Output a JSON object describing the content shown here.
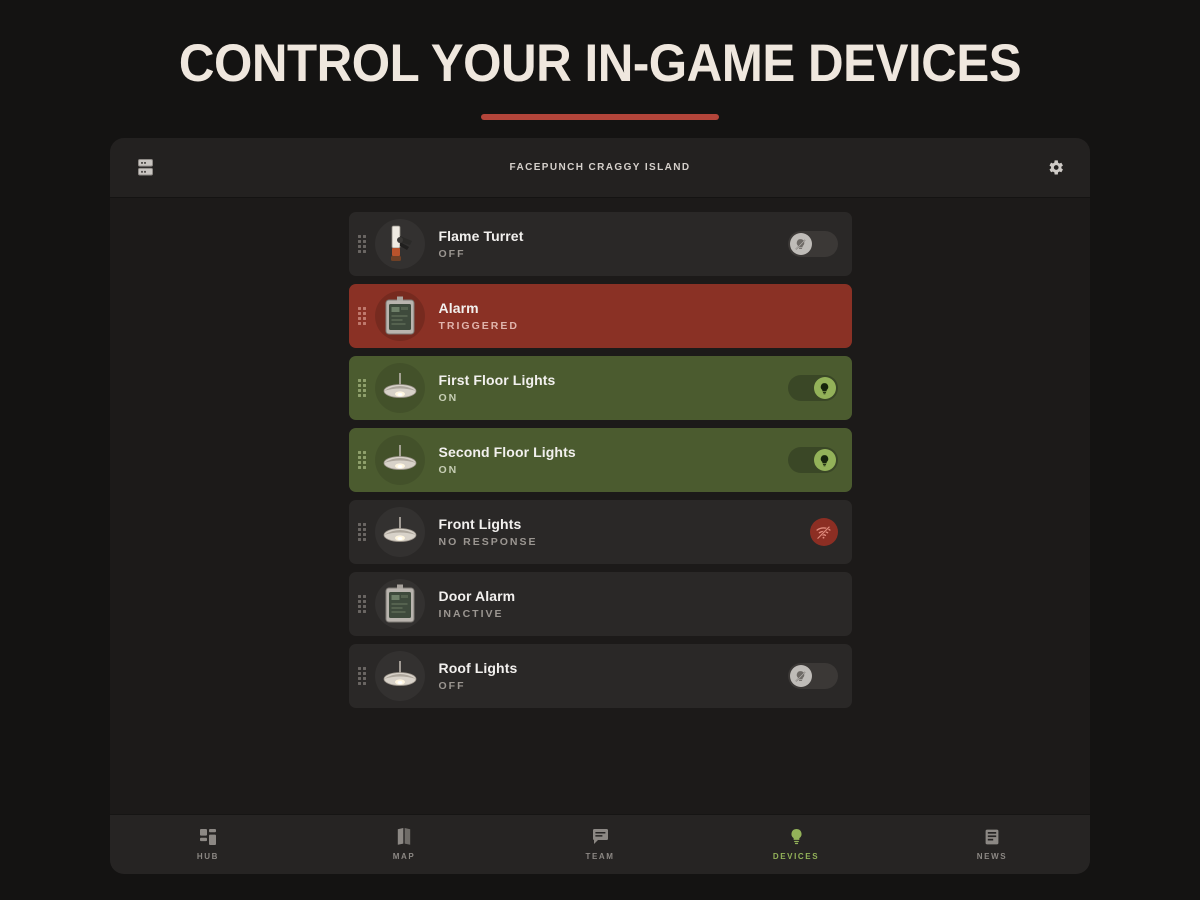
{
  "heading": {
    "title": "Control Your In-Game Devices",
    "accent_color": "#B4453A"
  },
  "app": {
    "header": {
      "title": "FACEPUNCH CRAGGY ISLAND",
      "left_icon": "server-stack-icon",
      "right_icon": "gear-icon"
    },
    "devices": [
      {
        "name": "Flame Turret",
        "status": "OFF",
        "state": "off",
        "icon": "flame-turret-icon",
        "control": "toggle",
        "toggle_on": false
      },
      {
        "name": "Alarm",
        "status": "TRIGGERED",
        "state": "alert",
        "icon": "alarm-box-icon",
        "control": "none",
        "toggle_on": false
      },
      {
        "name": "First Floor Lights",
        "status": "ON",
        "state": "on",
        "icon": "ceiling-lamp-icon",
        "control": "toggle",
        "toggle_on": true
      },
      {
        "name": "Second Floor Lights",
        "status": "ON",
        "state": "on",
        "icon": "ceiling-lamp-icon",
        "control": "toggle",
        "toggle_on": true
      },
      {
        "name": "Front Lights",
        "status": "NO RESPONSE",
        "state": "off",
        "icon": "ceiling-lamp-icon",
        "control": "offline",
        "toggle_on": false
      },
      {
        "name": "Door Alarm",
        "status": "INACTIVE",
        "state": "off",
        "icon": "alarm-box-icon",
        "control": "none",
        "toggle_on": false
      },
      {
        "name": "Roof Lights",
        "status": "OFF",
        "state": "off",
        "icon": "ceiling-lamp-icon",
        "control": "toggle",
        "toggle_on": false
      }
    ],
    "nav": [
      {
        "label": "HUB",
        "icon": "grid-dashboard-icon",
        "active": false
      },
      {
        "label": "MAP",
        "icon": "folded-map-icon",
        "active": false
      },
      {
        "label": "TEAM",
        "icon": "chat-bubble-icon",
        "active": false
      },
      {
        "label": "DEVICES",
        "icon": "lightbulb-icon",
        "active": true
      },
      {
        "label": "NEWS",
        "icon": "article-list-icon",
        "active": false
      }
    ]
  },
  "colors": {
    "page_background": "#141312",
    "panel_background": "#1C1A19",
    "row_default": "#2A2827",
    "row_on": "#4B5B2F",
    "row_alert": "#8A3125",
    "accent_green": "#93B259",
    "accent_red": "#B4453A"
  }
}
